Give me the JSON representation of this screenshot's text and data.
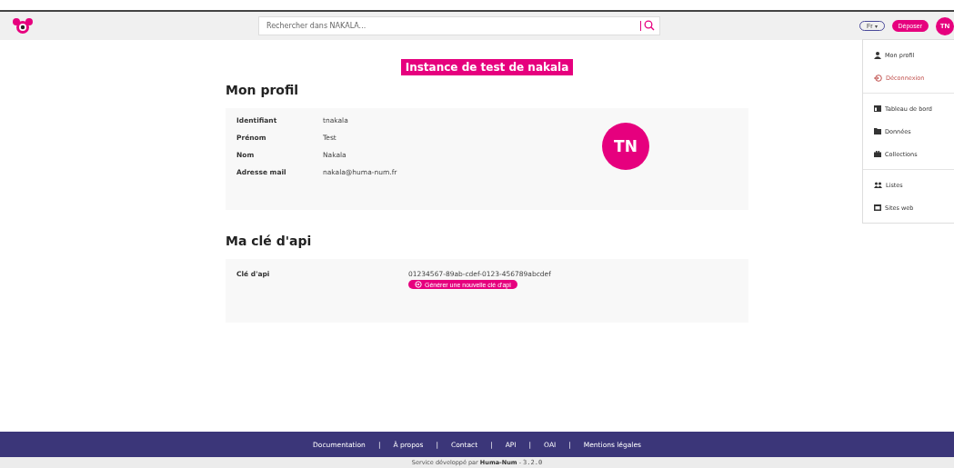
{
  "header": {
    "search": {
      "placeholder": "Rechercher dans NAKALA..."
    },
    "language": {
      "label": "Fr",
      "caret": "▾"
    },
    "deposit_button": "Déposer",
    "avatar": "TN"
  },
  "user_menu": {
    "groups": [
      [
        {
          "label": "Mon profil",
          "kind": "user",
          "danger": false
        },
        {
          "label": "Déconnexion",
          "kind": "logout",
          "danger": true
        }
      ],
      [
        {
          "label": "Tableau de bord",
          "kind": "table",
          "danger": false
        },
        {
          "label": "Données",
          "kind": "folder",
          "danger": false
        },
        {
          "label": "Collections",
          "kind": "briefcase",
          "danger": false
        }
      ],
      [
        {
          "label": "Listes",
          "kind": "users",
          "danger": false
        },
        {
          "label": "Sites web",
          "kind": "window",
          "danger": false
        }
      ]
    ]
  },
  "banner": "Instance de test de nakala",
  "profile": {
    "title": "Mon profil",
    "fields": [
      {
        "label": "Identifiant",
        "value": "tnakala"
      },
      {
        "label": "Prénom",
        "value": "Test"
      },
      {
        "label": "Nom",
        "value": "Nakala"
      },
      {
        "label": "Adresse mail",
        "value": "nakala@huma-num.fr"
      }
    ],
    "avatar": "TN"
  },
  "api": {
    "title": "Ma clé d'api",
    "label": "Clé d'api",
    "key": "01234567-89ab-cdef-0123-456789abcdef",
    "button": "Générer une nouvelle clé d'api"
  },
  "footer": {
    "links": [
      "Documentation",
      "À propos",
      "Contact",
      "API",
      "OAI",
      "Mentions légales"
    ],
    "separator": "|",
    "credit": "Service développé par **Huma-Num** - ",
    "version": "3.2.0"
  }
}
